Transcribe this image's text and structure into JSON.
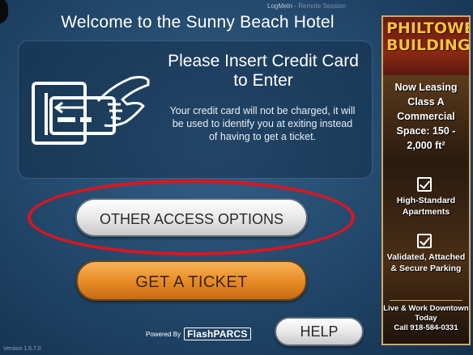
{
  "header": {
    "welcome": "Welcome to the Sunny Beach Hotel",
    "remote_session": "LogMeIn",
    "remote_session_sub": "- Remote Session"
  },
  "insert_panel": {
    "title": "Please Insert Credit Card to Enter",
    "description": "Your credit card will not be charged, it will be used to identify you at exiting instead of having to get a ticket.",
    "icon": "card-insert-icon"
  },
  "buttons": {
    "other_access": "OTHER ACCESS OPTIONS",
    "get_ticket": "GET A TICKET",
    "help": "HELP"
  },
  "footer": {
    "powered_by": "Powered By",
    "brand": "FlashPARCS",
    "version": "Version 1.6.7.0"
  },
  "ad": {
    "brand_line1": "PHILTOWER",
    "brand_line2": "BUILDING",
    "leasing": "Now Leasing Class A Commercial Space: 150 - 2,000 ft²",
    "feature1": "High-Standard Apartments",
    "feature2": "Validated, Attached & Secure Parking",
    "tagline": "Live & Work Downtown Today",
    "phone": "Call 918-584-0331"
  },
  "colors": {
    "background": "#244b6f",
    "highlight_ring": "#e0141c",
    "ticket_button": "#e98d28",
    "ad_brand": "#f3c23a"
  }
}
